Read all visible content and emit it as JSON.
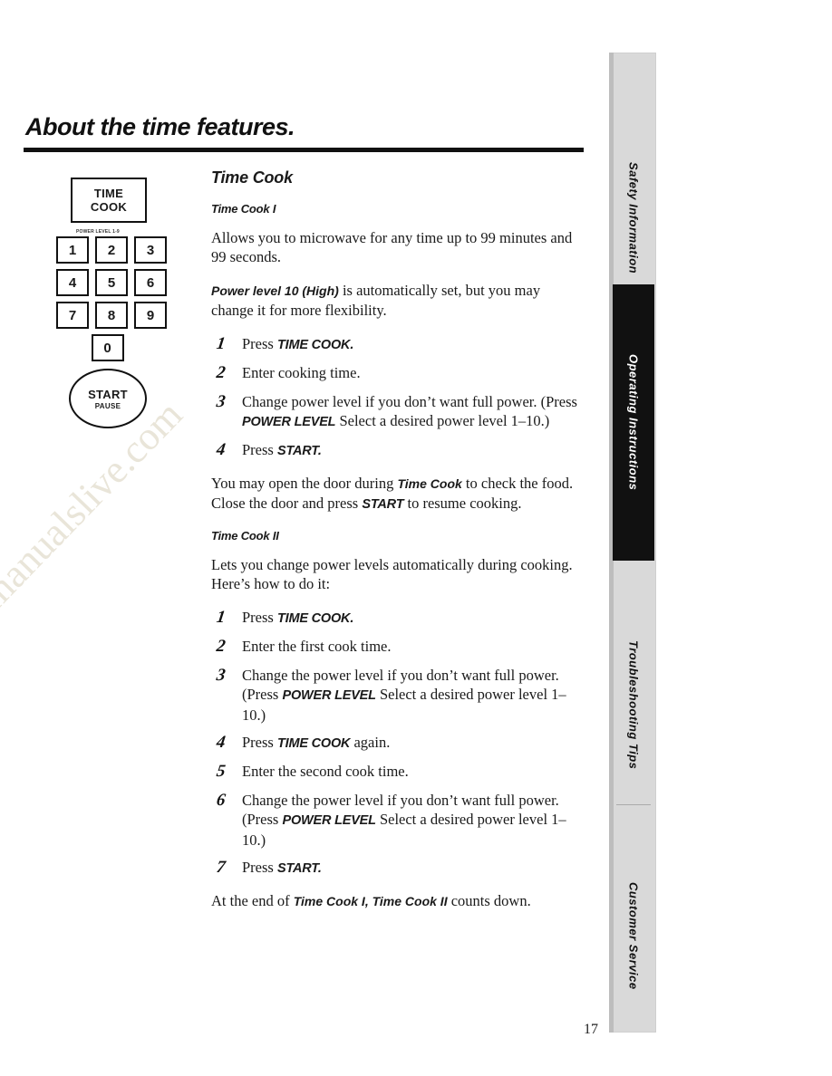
{
  "page": {
    "title": "About the time features.",
    "page_number": "17",
    "watermark": "manualslive.com"
  },
  "keypad": {
    "time_cook_button": {
      "line1": "TIME",
      "line2": "COOK"
    },
    "caption": "POWER LEVEL 1-9",
    "keys": [
      "1",
      "2",
      "3",
      "4",
      "5",
      "6",
      "7",
      "8",
      "9",
      "0"
    ],
    "start_button": {
      "line1": "START",
      "line2": "PAUSE"
    }
  },
  "content": {
    "section_title": "Time Cook",
    "time_cook_1": {
      "heading": "Time Cook I",
      "p1": "Allows you to microwave for any time up to 99 minutes and 99 seconds.",
      "p2_bold": "Power level 10 (High)",
      "p2_rest": " is automatically set, but you may change it for more flexibility.",
      "steps": [
        {
          "num": "1",
          "pre": "Press ",
          "bold": "TIME COOK.",
          "post": ""
        },
        {
          "num": "2",
          "pre": "Enter cooking time.",
          "bold": "",
          "post": ""
        },
        {
          "num": "3",
          "pre": "Change power level if you don’t want full power. (Press ",
          "bold": "POWER LEVEL",
          "post": " Select a desired power level 1–10.)"
        },
        {
          "num": "4",
          "pre": "Press ",
          "bold": "START.",
          "post": ""
        }
      ],
      "note_a": "You may open the door during ",
      "note_b": "Time Cook",
      "note_c": " to check the food. Close the door and press ",
      "note_d": "START",
      "note_e": " to resume cooking."
    },
    "time_cook_2": {
      "heading": "Time Cook II",
      "p1": "Lets you change power levels automatically during cooking. Here’s how to do it:",
      "steps": [
        {
          "num": "1",
          "pre": "Press ",
          "bold": "TIME COOK.",
          "post": ""
        },
        {
          "num": "2",
          "pre": "Enter the first cook time.",
          "bold": "",
          "post": ""
        },
        {
          "num": "3",
          "pre": "Change the power level if you don’t want full power. (Press ",
          "bold": "POWER LEVEL",
          "post": " Select a desired power level 1–10.)"
        },
        {
          "num": "4",
          "pre": "Press ",
          "bold": "TIME COOK",
          "post": " again."
        },
        {
          "num": "5",
          "pre": "Enter the second cook time.",
          "bold": "",
          "post": ""
        },
        {
          "num": "6",
          "pre": "Change the power level if you don’t want full power. (Press ",
          "bold": "POWER LEVEL",
          "post": " Select a desired power level 1–10.)"
        },
        {
          "num": "7",
          "pre": "Press ",
          "bold": "START.",
          "post": ""
        }
      ],
      "footer_a": "At the end of ",
      "footer_b": "Time Cook I, Time Cook II",
      "footer_c": " counts down."
    }
  },
  "tabs": [
    {
      "label": "Safety Information",
      "style": "light"
    },
    {
      "label": "Operating Instructions",
      "style": "dark"
    },
    {
      "label": "Troubleshooting Tips",
      "style": "light"
    },
    {
      "label": "Customer Service",
      "style": "light"
    }
  ]
}
